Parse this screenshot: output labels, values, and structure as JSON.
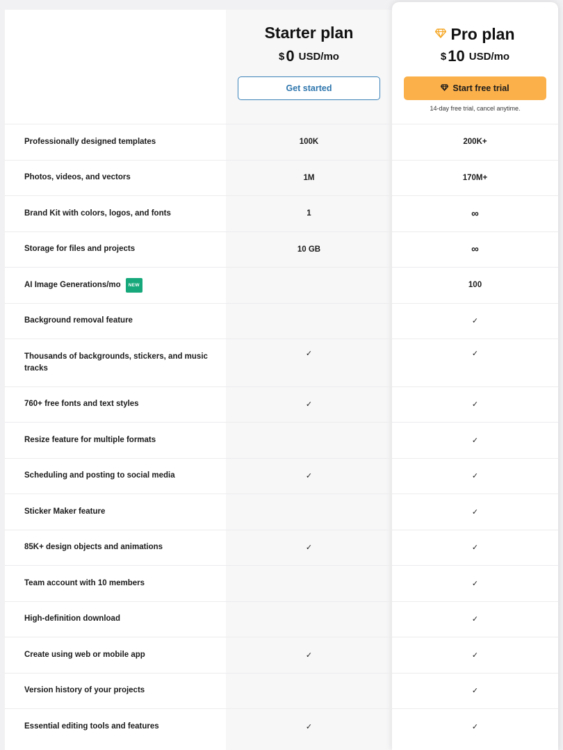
{
  "plans": {
    "starter": {
      "title": "Starter plan",
      "currency": "$",
      "amount": "0",
      "unit": "USD/mo",
      "button_label": "Get started"
    },
    "pro": {
      "title": "Pro plan",
      "currency": "$",
      "amount": "10",
      "unit": "USD/mo",
      "button_label": "Start free trial",
      "trial_note": "14-day free trial, cancel anytime.",
      "accent_color": "#fbb04a",
      "icon": "gem-icon"
    }
  },
  "new_badge": "NEW",
  "check_symbol": "✓",
  "infinity_symbol": "∞",
  "features": [
    {
      "label": "Professionally designed templates",
      "starter": "100K",
      "pro": "200K+"
    },
    {
      "label": "Photos, videos, and vectors",
      "starter": "1M",
      "pro": "170M+"
    },
    {
      "label": "Brand Kit with colors, logos, and fonts",
      "starter": "1",
      "pro": "∞"
    },
    {
      "label": "Storage for files and projects",
      "starter": "10 GB",
      "pro": "∞"
    },
    {
      "label": "AI Image Generations/mo",
      "starter": "",
      "pro": "100",
      "badge": true
    },
    {
      "label": "Background removal feature",
      "starter": "",
      "pro": "✓"
    },
    {
      "label": "Thousands of backgrounds, stickers, and music tracks",
      "starter": "✓",
      "pro": "✓",
      "tall": true
    },
    {
      "label": "760+ free fonts and text styles",
      "starter": "✓",
      "pro": "✓"
    },
    {
      "label": "Resize feature for multiple formats",
      "starter": "",
      "pro": "✓"
    },
    {
      "label": "Scheduling and posting to social media",
      "starter": "✓",
      "pro": "✓"
    },
    {
      "label": "Sticker Maker feature",
      "starter": "",
      "pro": "✓"
    },
    {
      "label": "85K+ design objects and animations",
      "starter": "✓",
      "pro": "✓"
    },
    {
      "label": "Team account with 10 members",
      "starter": "",
      "pro": "✓"
    },
    {
      "label": "High-definition download",
      "starter": "",
      "pro": "✓"
    },
    {
      "label": "Create using web or mobile app",
      "starter": "✓",
      "pro": "✓"
    },
    {
      "label": "Version history of your projects",
      "starter": "",
      "pro": "✓"
    },
    {
      "label": "Essential editing tools and features",
      "starter": "✓",
      "pro": "✓"
    }
  ]
}
